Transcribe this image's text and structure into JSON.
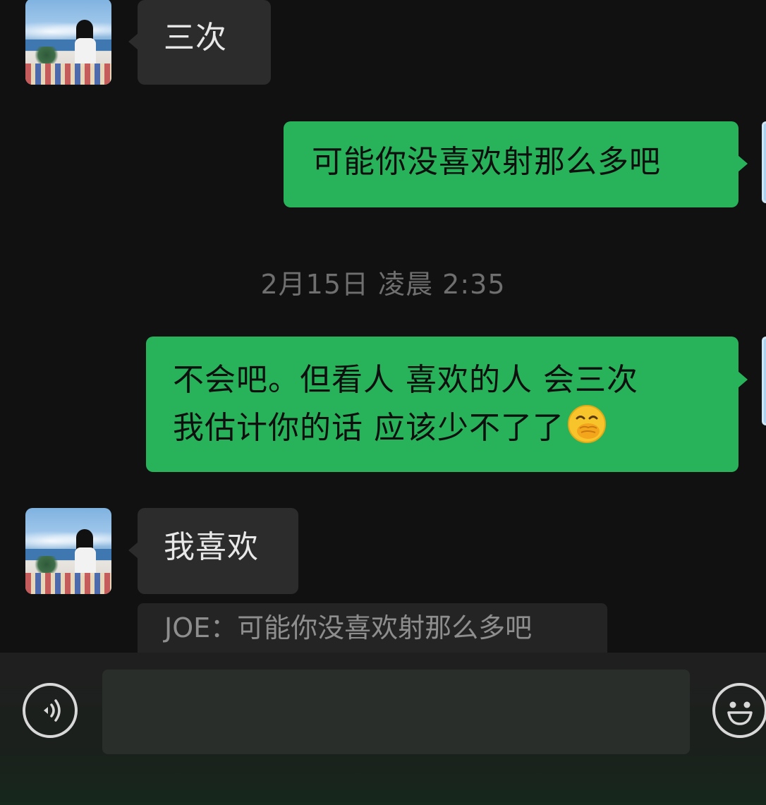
{
  "messages": [
    {
      "direction": "in",
      "text": "三次"
    },
    {
      "direction": "out",
      "text": "可能你没喜欢射那么多吧"
    },
    {
      "direction": "out",
      "lines": [
        "不会吧。但看人 喜欢的人 会三次",
        "我估计你的话 应该少不了了"
      ],
      "emoji": "hand-over-mouth-face-icon"
    },
    {
      "direction": "in",
      "text": "我喜欢",
      "quote": "JOE：可能你没喜欢射那么多吧"
    }
  ],
  "timestamp": "2月15日 凌晨 2:35",
  "composer": {
    "placeholder": "",
    "left_icon": "voice-icon",
    "right_icon": "emoji-icon"
  },
  "colors": {
    "background": "#111111",
    "incoming_bubble": "#2c2c2c",
    "outgoing_bubble": "#28b35a",
    "timestamp_text": "#6f6f6f"
  }
}
